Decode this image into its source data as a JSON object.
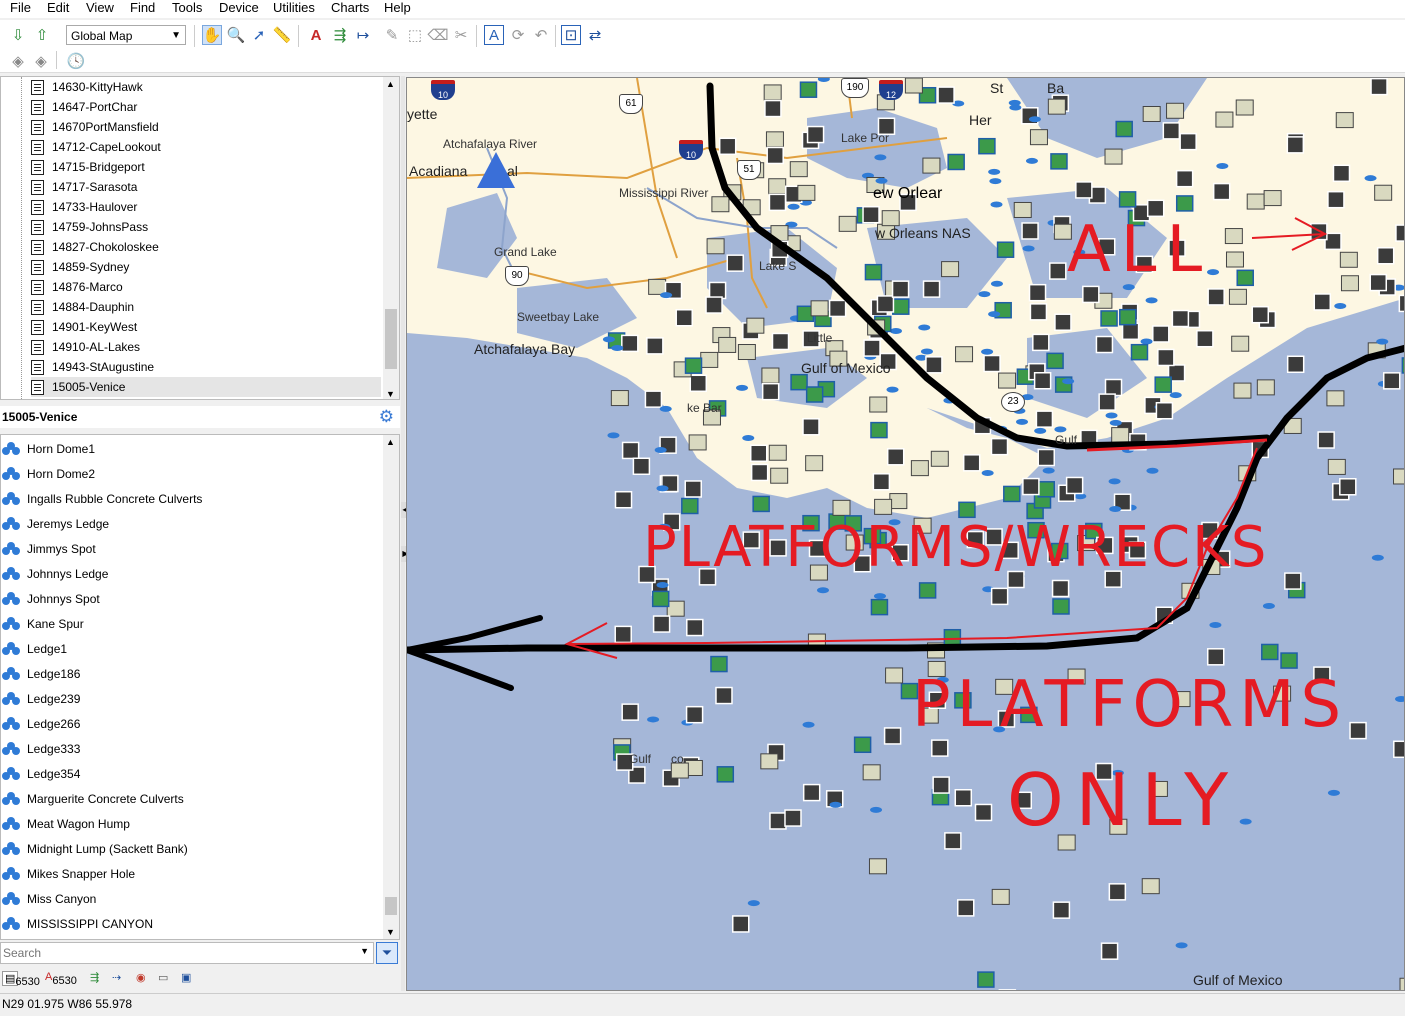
{
  "menu": [
    "File",
    "Edit",
    "View",
    "Find",
    "Tools",
    "Device",
    "Utilities",
    "Charts",
    "Help"
  ],
  "toolbar": {
    "map_select": "Global Map"
  },
  "files": [
    "14630-KittyHawk",
    "14647-PortChar",
    "14670PortMansfield",
    "14712-CapeLookout",
    "14715-Bridgeport",
    "14717-Sarasota",
    "14733-Haulover",
    "14759-JohnsPass",
    "14827-Chokoloskee",
    "14859-Sydney",
    "14876-Marco",
    "14884-Dauphin",
    "14901-KeyWest",
    "14910-AL-Lakes",
    "14943-StAugustine",
    "15005-Venice"
  ],
  "selected_file": "15005-Venice",
  "points": [
    "Horn Dome1",
    "Horn Dome2",
    "Ingalls Rubble Concrete Culverts",
    "Jeremys Ledge",
    "Jimmys Spot",
    "Johnnys Ledge",
    "Johnnys Spot",
    "Kane Spur",
    "Ledge1",
    "Ledge186",
    "Ledge239",
    "Ledge266",
    "Ledge333",
    "Ledge354",
    "Marguerite Concrete Culverts",
    "Meat Wagon Hump",
    "Midnight Lump (Sackett Bank)",
    "Mikes Snapper Hole",
    "Miss Canyon",
    "MISSISSIPPI CANYON"
  ],
  "search": {
    "placeholder": "Search"
  },
  "bottom_tabs": {
    "waypoints_count": "6530",
    "routes_count": "6530"
  },
  "status": {
    "coords": "N29 01.975 W86 55.978"
  },
  "map": {
    "labels": {
      "lafayette": "yette",
      "atchafalaya_river": "Atchafalaya River",
      "acadiana": "Acadiana",
      "acadiana_rest": "al",
      "mississippi_river": "Mississippi River",
      "grand_lake": "Grand Lake",
      "sweetbay_lake": "Sweetbay Lake",
      "atchafalaya_bay": "Atchafalaya Bay",
      "lake_pon": "Lake Por",
      "new_orleans": "ew Orlear",
      "new_orleans_nas": "w Orleans NAS",
      "lake_s": "Lake S",
      "little": "Little",
      "gulf_mexico_mid": "Gulf of Mexico",
      "lake_bar": "ke Bar",
      "gulf_mexico_low": "Gulf      co",
      "gulf_mexico_bottom": "Gulf of Mexico",
      "gulf_right": "Gulf",
      "here": "Her",
      "st_b": "St",
      "bay_b": "Ba"
    },
    "shields": {
      "i10a": "10",
      "i10b": "10",
      "i12": "12",
      "us61": "61",
      "us190": "190",
      "us51": "51",
      "us90": "90",
      "s23": "23"
    },
    "annotations": {
      "all": "ALL",
      "platforms_wrecks": "PLATFORMS/WRECKS",
      "platforms": "PLATFORMS",
      "only": "ONLY"
    },
    "colors": {
      "water": "#a5b7d8",
      "land": "#fdf7e3",
      "pen_black": "#000000",
      "pen_red": "#e51b23"
    }
  }
}
